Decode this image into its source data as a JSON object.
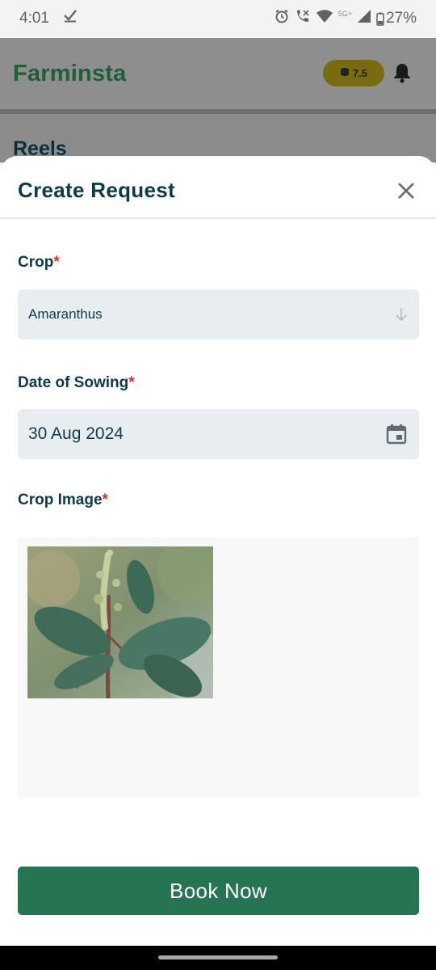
{
  "status_bar": {
    "time": "4:01",
    "network": "5G+",
    "battery": "27%",
    "icons": [
      "check-icon",
      "alarm-icon",
      "wifi-call-icon",
      "wifi-icon",
      "signal-icon",
      "battery-icon"
    ]
  },
  "app": {
    "brand": "Farminsta",
    "coins": "7.5",
    "section_title": "Reels",
    "colors": {
      "brand": "#1f5f37",
      "coin_badge": "#f0d624"
    }
  },
  "sheet": {
    "title": "Create Request",
    "fields": {
      "crop": {
        "label": "Crop",
        "required_mark": "*",
        "value": "Amaranthus"
      },
      "sowing": {
        "label": "Date of Sowing",
        "required_mark": "*",
        "value": "30 Aug 2024"
      },
      "image": {
        "label": "Crop Image",
        "required_mark": "*"
      }
    },
    "submit_label": "Book Now",
    "colors": {
      "primary": "#267452",
      "field_bg": "#e8edf1",
      "title": "#0e3a4a",
      "required": "#d32f2f"
    }
  }
}
